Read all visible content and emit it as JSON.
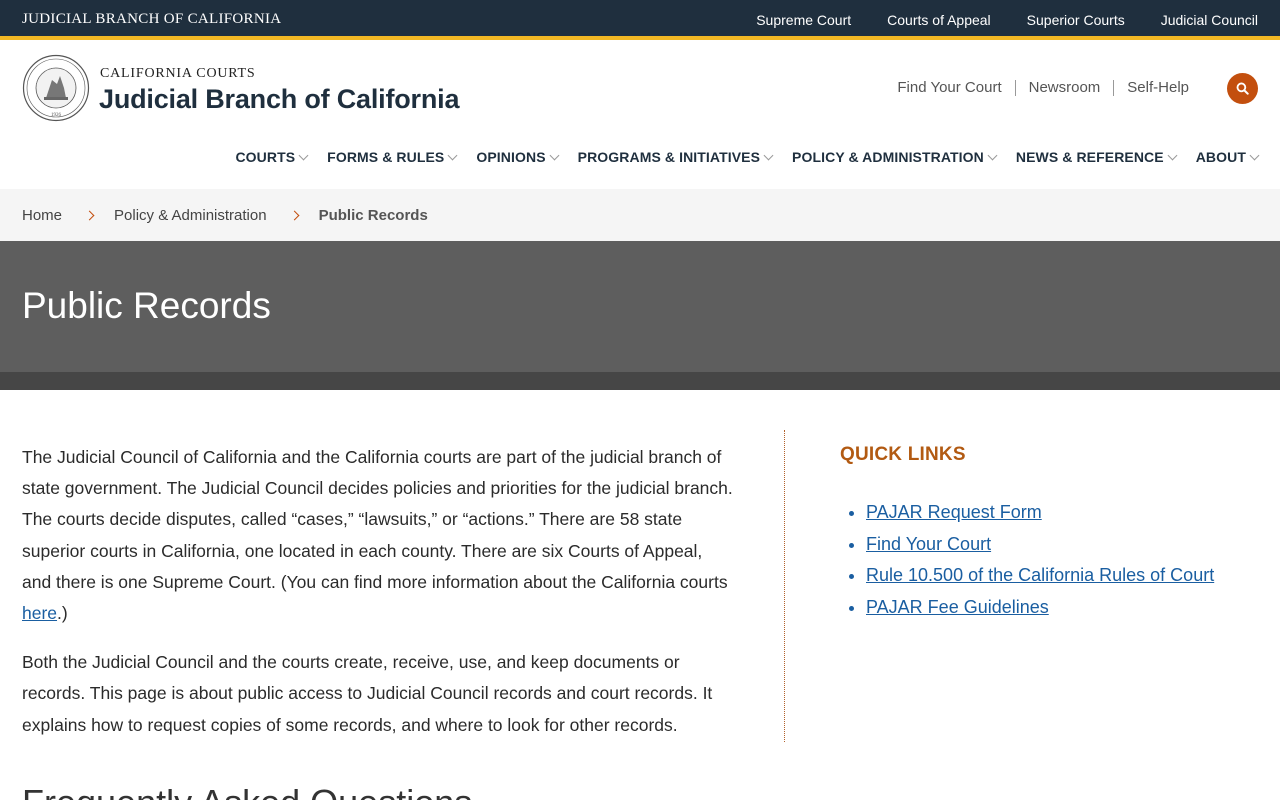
{
  "utility_bar": {
    "title": "JUDICIAL BRANCH OF CALIFORNIA",
    "links": [
      "Supreme Court",
      "Courts of Appeal",
      "Superior Courts",
      "Judicial Council"
    ]
  },
  "header": {
    "brand_small": "CALIFORNIA COURTS",
    "brand_big": "Judicial Branch of California",
    "seal_text_top": "JUDICIAL COUNCIL of CALIFORNIA",
    "seal_year": "1926",
    "links": [
      "Find Your Court",
      "Newsroom",
      "Self-Help"
    ],
    "search_icon": "search-icon"
  },
  "main_nav": [
    "COURTS",
    "FORMS & RULES",
    "OPINIONS",
    "PROGRAMS & INITIATIVES",
    "POLICY & ADMINISTRATION",
    "NEWS & REFERENCE",
    "ABOUT"
  ],
  "breadcrumb": [
    "Home",
    "Policy & Administration",
    "Public Records"
  ],
  "hero": {
    "title": "Public Records"
  },
  "content": {
    "p1_before_link": "The Judicial Council of California and the California courts are part of the judicial branch of state government. The Judicial Council decides policies and priorities for the judicial branch. The courts decide disputes, called “cases,” “lawsuits,” or “actions.” There are 58 state superior courts in California, one located in each county. There are six Courts of Appeal, and there is one Supreme Court. (You can find more information about the California courts ",
    "p1_link": "here",
    "p1_after_link": ".)",
    "p2": "Both the Judicial Council and the courts create, receive, use, and keep documents or records. This page is about public access to Judicial Council records and court records. It explains how to request copies of some records, and where to look for other records.",
    "faq_heading": "Frequently Asked Questions"
  },
  "sidebar": {
    "title": "QUICK LINKS",
    "links": [
      "PAJAR Request Form",
      "Find Your Court",
      "Rule 10.500 of the California Rules of Court",
      "PAJAR Fee Guidelines"
    ]
  },
  "colors": {
    "utility_bg": "#1f2f3e",
    "accent_gold": "#f2b824",
    "accent_orange": "#c34f0e",
    "hero_bg": "#5e5e5e",
    "link_blue": "#1a5ea1"
  }
}
